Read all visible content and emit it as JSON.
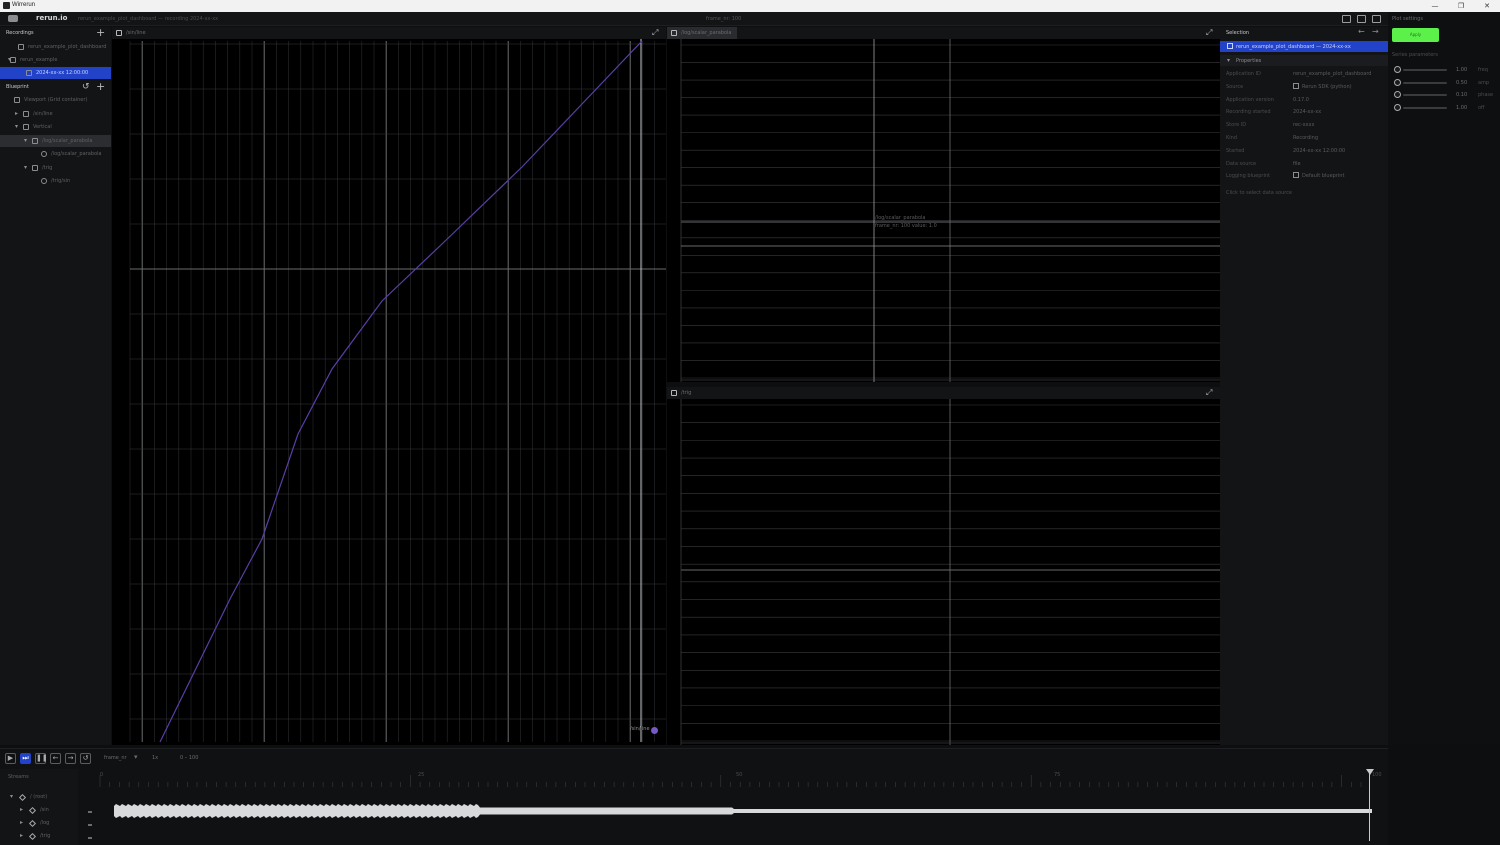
{
  "window": {
    "title": "Wirrerun",
    "controls": [
      "—",
      "❐",
      "✕"
    ]
  },
  "topbar": {
    "logo": "rerun.io",
    "recording": "rerun_example_plot_dashboard — recording 2024-xx-xx",
    "time": "frame_nr: 100"
  },
  "blueprint": {
    "recordings_title": "Recordings",
    "recordings": [
      {
        "label": "rerun_example_plot_dashboard",
        "kind": "app"
      },
      {
        "label": "rerun_example",
        "kind": "app"
      },
      {
        "label": "2024-xx-xx 12:00:00",
        "kind": "recording",
        "selected": true
      }
    ],
    "blueprint_title": "Blueprint",
    "tree": [
      {
        "label": "Viewport (Grid container)",
        "depth": 0,
        "kind": "grid",
        "arrow": ""
      },
      {
        "label": "/sin/line",
        "depth": 1,
        "kind": "view",
        "arrow": "▸"
      },
      {
        "label": "Vertical",
        "depth": 1,
        "kind": "grid",
        "arrow": "▾"
      },
      {
        "label": "/log/scalar_parabola",
        "depth": 2,
        "kind": "view",
        "arrow": "▾",
        "hover": true
      },
      {
        "label": "/log/scalar_parabola",
        "depth": 3,
        "kind": "entity",
        "arrow": ""
      },
      {
        "label": "/trig",
        "depth": 2,
        "kind": "view",
        "arrow": "▾"
      },
      {
        "label": "/trig/sin",
        "depth": 3,
        "kind": "entity",
        "arrow": ""
      }
    ]
  },
  "views": {
    "main": {
      "tab": "/sin/line",
      "legend": "/sin/line"
    },
    "top_right": {
      "tab": "/log/scalar_parabola",
      "annotation_line1": "/log/scalar_parabola",
      "annotation_line2": "frame_nr: 100  value: 1.0"
    },
    "bottom_right": {
      "tab": "/trig"
    }
  },
  "selection": {
    "title": "Selection",
    "item": "rerun_example_plot_dashboard — 2024-xx-xx",
    "section": "Properties",
    "rows": [
      {
        "key": "Application ID",
        "value": "rerun_example_plot_dashboard"
      },
      {
        "key": "Source",
        "value": "Rerun SDK (python)",
        "icon": true
      },
      {
        "key": "Application version",
        "value": "0.17.0"
      },
      {
        "key": "Recording started",
        "value": "2024-xx-xx"
      },
      {
        "key": "Store ID",
        "value": "rec-xxxx"
      },
      {
        "key": "Kind",
        "value": "Recording"
      },
      {
        "key": "Started",
        "value": "2024-xx-xx 12:00:00"
      },
      {
        "key": "Data source",
        "value": "file"
      },
      {
        "key": "Logging blueprint",
        "value": "Default blueprint",
        "icon": true
      }
    ],
    "footer": "Click to select data source"
  },
  "settings": {
    "title": "Plot settings",
    "button": "Apply",
    "subtitle": "Series parameters",
    "sliders": [
      {
        "value": "1.00",
        "unit": "freq",
        "level": 0.0
      },
      {
        "value": "0.50",
        "unit": "amp",
        "level": 0.0
      },
      {
        "value": "0.10",
        "unit": "phase",
        "level": 0.0
      },
      {
        "value": "1.00",
        "unit": "off",
        "level": 0.0
      }
    ]
  },
  "timeline": {
    "timeline_name": "frame_nr",
    "speed": "1x",
    "range": "0 – 100",
    "streams_title": "Streams",
    "rows": [
      {
        "label": "/ (root)",
        "depth": 0,
        "arrow": "▾"
      },
      {
        "label": "/sin",
        "depth": 1,
        "arrow": "▸"
      },
      {
        "label": "/log",
        "depth": 1,
        "arrow": "▸"
      },
      {
        "label": "/trig",
        "depth": 1,
        "arrow": "▸"
      }
    ],
    "ticks": [
      "0",
      "25",
      "50",
      "75",
      "100"
    ]
  },
  "colors": {
    "accent": "#2243c8",
    "series": "#5b3fa6",
    "button": "#5cf04b"
  },
  "icons": [
    "menu-icon",
    "plus-icon",
    "reset-icon",
    "maximize-icon",
    "play-icon",
    "pause-icon",
    "loop-icon"
  ]
}
